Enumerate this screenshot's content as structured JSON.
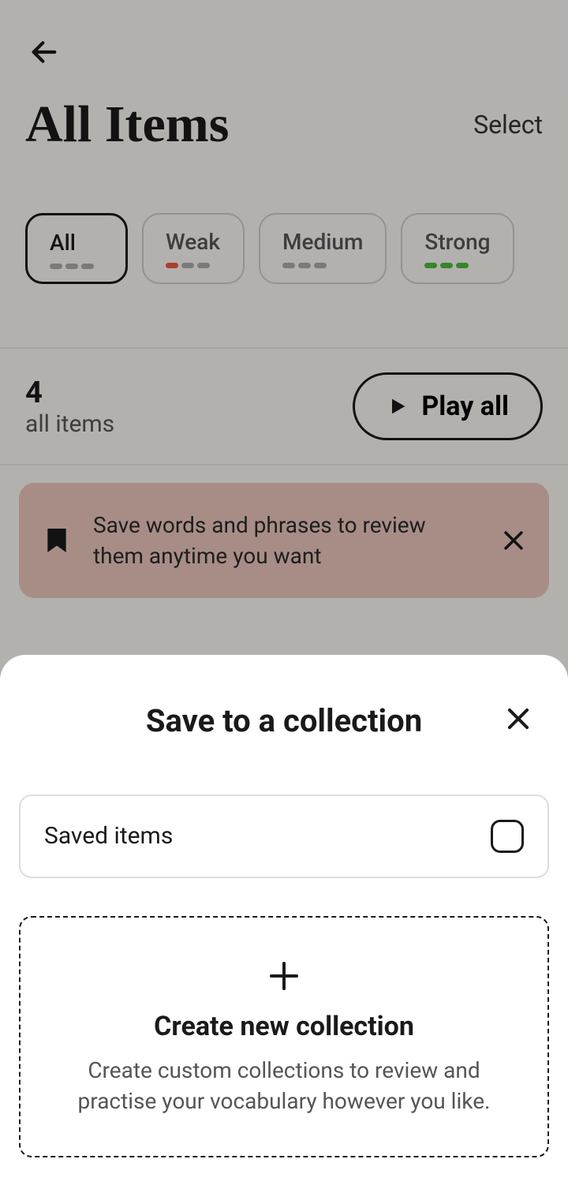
{
  "header": {
    "title": "All Items",
    "select_label": "Select"
  },
  "filters": {
    "all": "All",
    "weak": "Weak",
    "medium": "Medium",
    "strong": "Strong"
  },
  "items": {
    "count": "4",
    "label": "all items",
    "play_label": "Play all"
  },
  "banner": {
    "text": "Save words and phrases to review them anytime you want"
  },
  "sheet": {
    "title": "Save to a collection",
    "collection_name": "Saved items",
    "create_title": "Create new collection",
    "create_desc": "Create custom collections to review and practise your vocabulary however you like."
  }
}
